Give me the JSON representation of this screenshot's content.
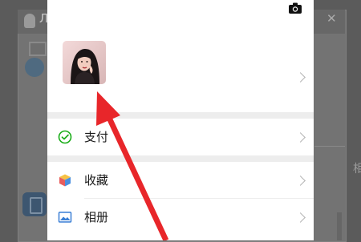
{
  "background_window": {
    "title": "Л",
    "close_glyph": "✕",
    "side_text": "相"
  },
  "profile": {
    "camera_icon": "camera-icon",
    "avatar_icon": "avatar-photo"
  },
  "menu": {
    "items": [
      {
        "label": "支付",
        "icon": "wechat-pay-icon"
      },
      {
        "label": "收藏",
        "icon": "favorites-cube-icon"
      },
      {
        "label": "相册",
        "icon": "album-picture-icon"
      }
    ]
  },
  "colors": {
    "annotation_arrow": "#e8262a",
    "pay_green": "#1aad19",
    "album_blue": "#3a7fd5"
  }
}
